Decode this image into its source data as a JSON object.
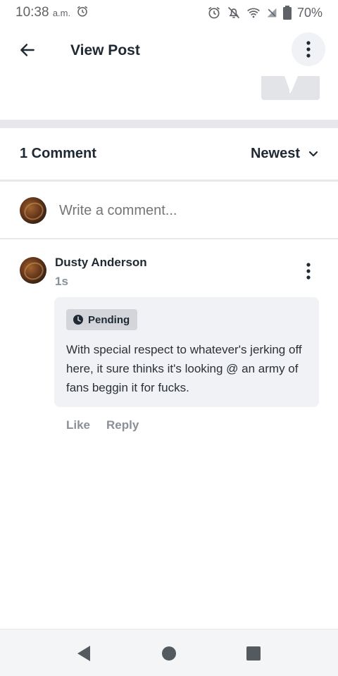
{
  "status_bar": {
    "time": "10:38",
    "time_suffix": "a.m.",
    "battery": "70%"
  },
  "app_bar": {
    "title": "View Post"
  },
  "comments": {
    "count_label": "1 Comment",
    "sort_label": "Newest",
    "write_placeholder": "Write a comment...",
    "items": [
      {
        "author": "Dusty Anderson",
        "time_ago": "1s",
        "status": "Pending",
        "text": "With special respect to whatever's jerking off here, it sure thinks it's looking @ an army of fans beggin it for fucks.",
        "like_label": "Like",
        "reply_label": "Reply"
      }
    ]
  },
  "colors": {
    "text_primary": "#1f2933",
    "text_muted": "#8a8f98",
    "bubble_bg": "#f1f2f5",
    "badge_bg": "#d3d5da",
    "divider": "#e6e8ec"
  },
  "icons": {
    "status": [
      "alarm-icon",
      "alarm-icon",
      "notifications-off-icon",
      "wifi-icon",
      "no-signal-icon",
      "battery-icon"
    ],
    "app_bar": [
      "arrow-back-icon",
      "more-vert-icon"
    ],
    "sort": "chevron-down-icon",
    "badge": "clock-icon",
    "nav": [
      "nav-back-triangle-icon",
      "nav-home-circle-icon",
      "nav-recents-square-icon"
    ]
  }
}
